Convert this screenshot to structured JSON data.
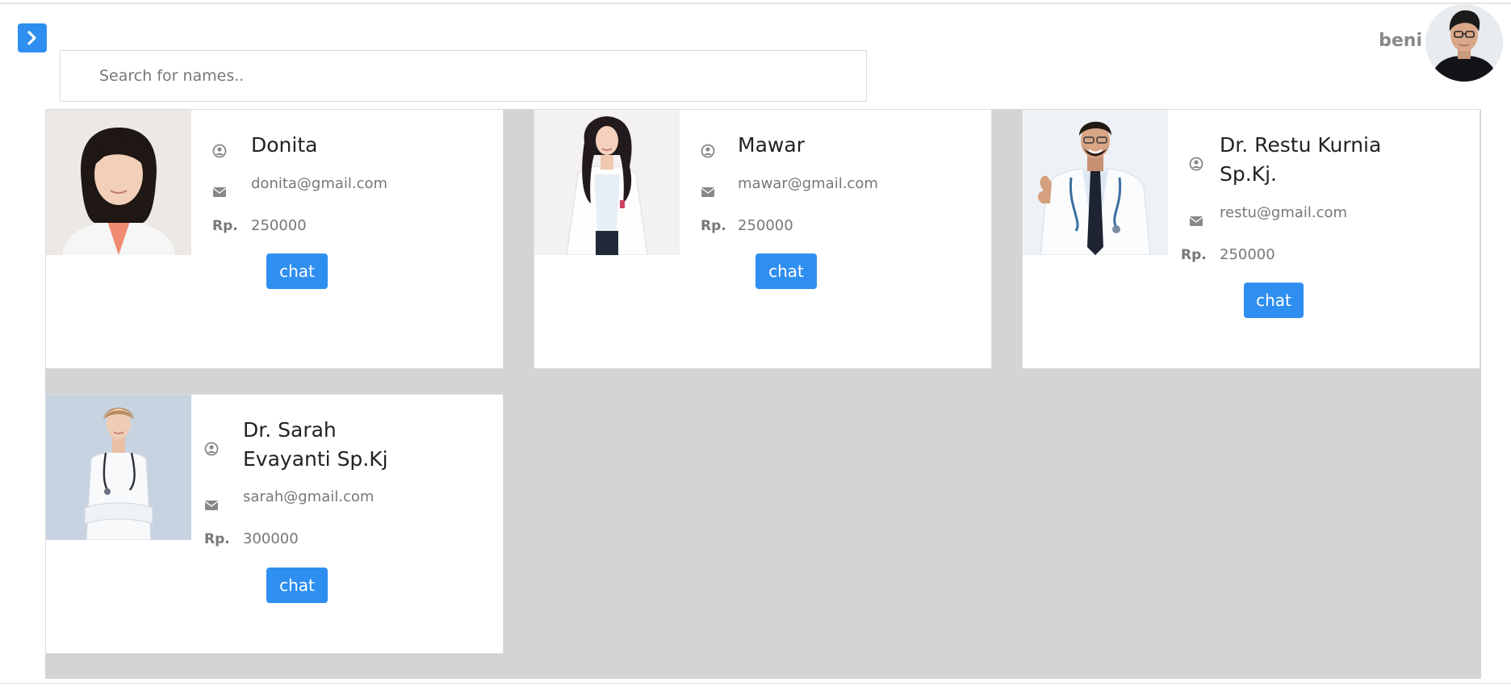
{
  "header": {
    "search_placeholder": "Search for names..",
    "user_name": "beni"
  },
  "doctors": [
    {
      "name": "Donita",
      "email": "donita@gmail.com",
      "price_label": "Rp.",
      "price": "250000",
      "chat_label": "chat"
    },
    {
      "name": "Mawar",
      "email": "mawar@gmail.com",
      "price_label": "Rp.",
      "price": "250000",
      "chat_label": "chat"
    },
    {
      "name": "Dr. Restu Kurnia Sp.Kj.",
      "email": "restu@gmail.com",
      "price_label": "Rp.",
      "price": "250000",
      "chat_label": "chat"
    },
    {
      "name": "Dr. Sarah Evayanti Sp.Kj",
      "email": "sarah@gmail.com",
      "price_label": "Rp.",
      "price": "300000",
      "chat_label": "chat"
    }
  ],
  "icons": {
    "toggle": "chevron-right-icon",
    "name": "user-circle-icon",
    "email": "envelope-icon"
  },
  "colors": {
    "accent": "#2f8ff0",
    "grid_background": "#d4d4d4"
  }
}
